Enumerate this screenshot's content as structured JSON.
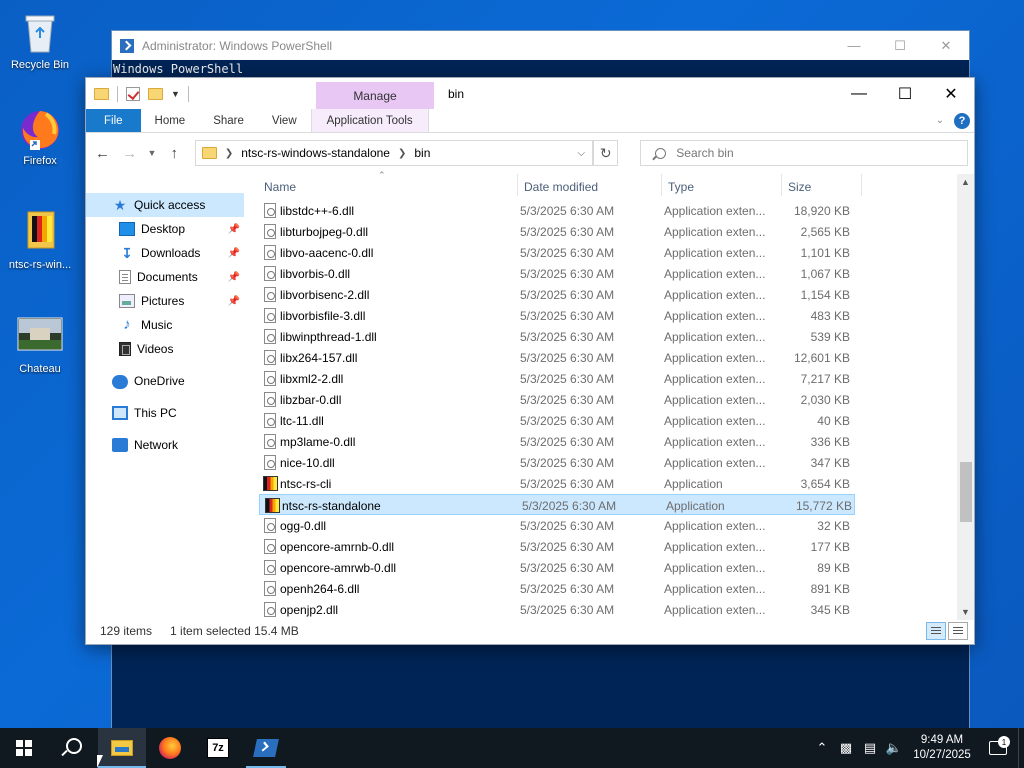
{
  "desktop": {
    "icons": [
      {
        "label": "Recycle Bin",
        "icon": "recycle-bin-icon"
      },
      {
        "label": "Firefox",
        "icon": "firefox-icon"
      },
      {
        "label": "ntsc-rs-win...",
        "icon": "ntsc-rs-icon"
      },
      {
        "label": "Chateau",
        "icon": "image-thumbnail-icon"
      }
    ]
  },
  "powershell": {
    "title": "Administrator: Windows PowerShell",
    "line1": "Windows PowerShell"
  },
  "explorer": {
    "manage_tab": "Manage",
    "title": "bin",
    "tabs": {
      "file": "File",
      "home": "Home",
      "share": "Share",
      "view": "View",
      "app_tools": "Application Tools"
    },
    "address": {
      "segments": [
        "ntsc-rs-windows-standalone",
        "bin"
      ]
    },
    "search_placeholder": "Search bin",
    "nav": {
      "quick_access": "Quick access",
      "desktop": "Desktop",
      "downloads": "Downloads",
      "documents": "Documents",
      "pictures": "Pictures",
      "music": "Music",
      "videos": "Videos",
      "onedrive": "OneDrive",
      "this_pc": "This PC",
      "network": "Network"
    },
    "columns": {
      "name": "Name",
      "date": "Date modified",
      "type": "Type",
      "size": "Size"
    },
    "files": [
      {
        "name": "libstdc++-6.dll",
        "date": "5/3/2025 6:30 AM",
        "type": "Application exten...",
        "size": "18,920 KB",
        "kind": "dll"
      },
      {
        "name": "libturbojpeg-0.dll",
        "date": "5/3/2025 6:30 AM",
        "type": "Application exten...",
        "size": "2,565 KB",
        "kind": "dll"
      },
      {
        "name": "libvo-aacenc-0.dll",
        "date": "5/3/2025 6:30 AM",
        "type": "Application exten...",
        "size": "1,101 KB",
        "kind": "dll"
      },
      {
        "name": "libvorbis-0.dll",
        "date": "5/3/2025 6:30 AM",
        "type": "Application exten...",
        "size": "1,067 KB",
        "kind": "dll"
      },
      {
        "name": "libvorbisenc-2.dll",
        "date": "5/3/2025 6:30 AM",
        "type": "Application exten...",
        "size": "1,154 KB",
        "kind": "dll"
      },
      {
        "name": "libvorbisfile-3.dll",
        "date": "5/3/2025 6:30 AM",
        "type": "Application exten...",
        "size": "483 KB",
        "kind": "dll"
      },
      {
        "name": "libwinpthread-1.dll",
        "date": "5/3/2025 6:30 AM",
        "type": "Application exten...",
        "size": "539 KB",
        "kind": "dll"
      },
      {
        "name": "libx264-157.dll",
        "date": "5/3/2025 6:30 AM",
        "type": "Application exten...",
        "size": "12,601 KB",
        "kind": "dll"
      },
      {
        "name": "libxml2-2.dll",
        "date": "5/3/2025 6:30 AM",
        "type": "Application exten...",
        "size": "7,217 KB",
        "kind": "dll"
      },
      {
        "name": "libzbar-0.dll",
        "date": "5/3/2025 6:30 AM",
        "type": "Application exten...",
        "size": "2,030 KB",
        "kind": "dll"
      },
      {
        "name": "ltc-11.dll",
        "date": "5/3/2025 6:30 AM",
        "type": "Application exten...",
        "size": "40 KB",
        "kind": "dll"
      },
      {
        "name": "mp3lame-0.dll",
        "date": "5/3/2025 6:30 AM",
        "type": "Application exten...",
        "size": "336 KB",
        "kind": "dll"
      },
      {
        "name": "nice-10.dll",
        "date": "5/3/2025 6:30 AM",
        "type": "Application exten...",
        "size": "347 KB",
        "kind": "dll"
      },
      {
        "name": "ntsc-rs-cli",
        "date": "5/3/2025 6:30 AM",
        "type": "Application",
        "size": "3,654 KB",
        "kind": "app"
      },
      {
        "name": "ntsc-rs-standalone",
        "date": "5/3/2025 6:30 AM",
        "type": "Application",
        "size": "15,772 KB",
        "kind": "app",
        "selected": true
      },
      {
        "name": "ogg-0.dll",
        "date": "5/3/2025 6:30 AM",
        "type": "Application exten...",
        "size": "32 KB",
        "kind": "dll"
      },
      {
        "name": "opencore-amrnb-0.dll",
        "date": "5/3/2025 6:30 AM",
        "type": "Application exten...",
        "size": "177 KB",
        "kind": "dll"
      },
      {
        "name": "opencore-amrwb-0.dll",
        "date": "5/3/2025 6:30 AM",
        "type": "Application exten...",
        "size": "89 KB",
        "kind": "dll"
      },
      {
        "name": "openh264-6.dll",
        "date": "5/3/2025 6:30 AM",
        "type": "Application exten...",
        "size": "891 KB",
        "kind": "dll"
      },
      {
        "name": "openjp2.dll",
        "date": "5/3/2025 6:30 AM",
        "type": "Application exten...",
        "size": "345 KB",
        "kind": "dll"
      }
    ],
    "status": {
      "items": "129 items",
      "selected": "1 item selected",
      "size": "15.4 MB"
    }
  },
  "taskbar": {
    "time": "9:49 AM",
    "date": "10/27/2025",
    "seven_zip": "7z",
    "notification_count": "1"
  },
  "colors": {
    "accent": "#1979ca",
    "selection": "#cce8ff",
    "manage_tab": "#e8c7f5"
  }
}
